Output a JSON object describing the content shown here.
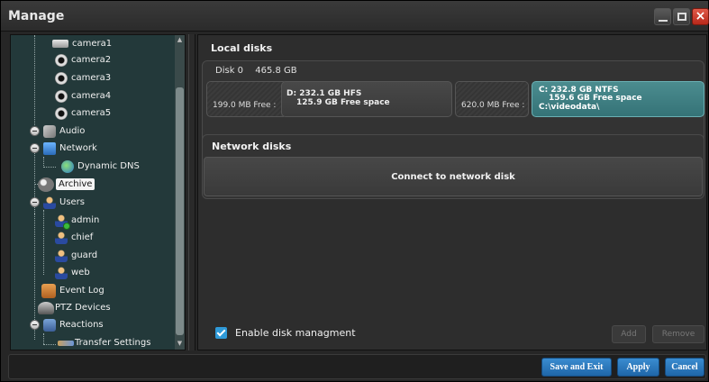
{
  "window": {
    "title": "Manage",
    "close_glyph": "×"
  },
  "tree": {
    "items": [
      {
        "label": "camera1",
        "icon": "box-camera-icon"
      },
      {
        "label": "camera2",
        "icon": "dome-camera-icon"
      },
      {
        "label": "camera3",
        "icon": "dome-camera-icon"
      },
      {
        "label": "camera4",
        "icon": "dome-camera-icon"
      },
      {
        "label": "camera5",
        "icon": "dome-camera-icon"
      },
      {
        "label": "Audio",
        "icon": "audio-icon"
      },
      {
        "label": "Network",
        "icon": "network-icon"
      },
      {
        "label": "Dynamic DNS",
        "icon": "globe-icon"
      },
      {
        "label": "Archive",
        "icon": "archive-icon"
      },
      {
        "label": "Users",
        "icon": "users-icon"
      },
      {
        "label": "admin",
        "icon": "user-icon"
      },
      {
        "label": "chief",
        "icon": "user-icon"
      },
      {
        "label": "guard",
        "icon": "user-icon"
      },
      {
        "label": "web",
        "icon": "user-icon"
      },
      {
        "label": "Event Log",
        "icon": "event-log-icon"
      },
      {
        "label": "PTZ Devices",
        "icon": "ptz-icon"
      },
      {
        "label": "Reactions",
        "icon": "reactions-icon"
      },
      {
        "label": "Transfer Settings",
        "icon": "transfer-icon"
      }
    ],
    "selected": "Archive",
    "scroll_up": "▲",
    "scroll_down": "▼"
  },
  "local_disks": {
    "title": "Local disks",
    "disk_name": "Disk 0",
    "disk_size": "465.8 GB",
    "partitions": [
      {
        "free_text": "199.0 MB Free :"
      },
      {
        "name": "D: 232.1 GB HFS",
        "free": "125.9 GB Free space"
      },
      {
        "free_text": "620.0 MB Free :"
      },
      {
        "name": "C: 232.8 GB NTFS",
        "free": "159.6 GB Free space",
        "path": "C:\\videodata\\"
      }
    ]
  },
  "network_disks": {
    "title": "Network disks",
    "connect_label": "Connect to network disk"
  },
  "options": {
    "enable_label": "Enable disk managment",
    "enable_checked": true
  },
  "buttons": {
    "add": "Add",
    "remove": "Remove",
    "save_exit": "Save and Exit",
    "apply": "Apply",
    "cancel": "Cancel"
  },
  "colors": {
    "accent": "#2a7bc0",
    "selected_partition": "#3f8185",
    "tree_bg": "#23393a"
  }
}
